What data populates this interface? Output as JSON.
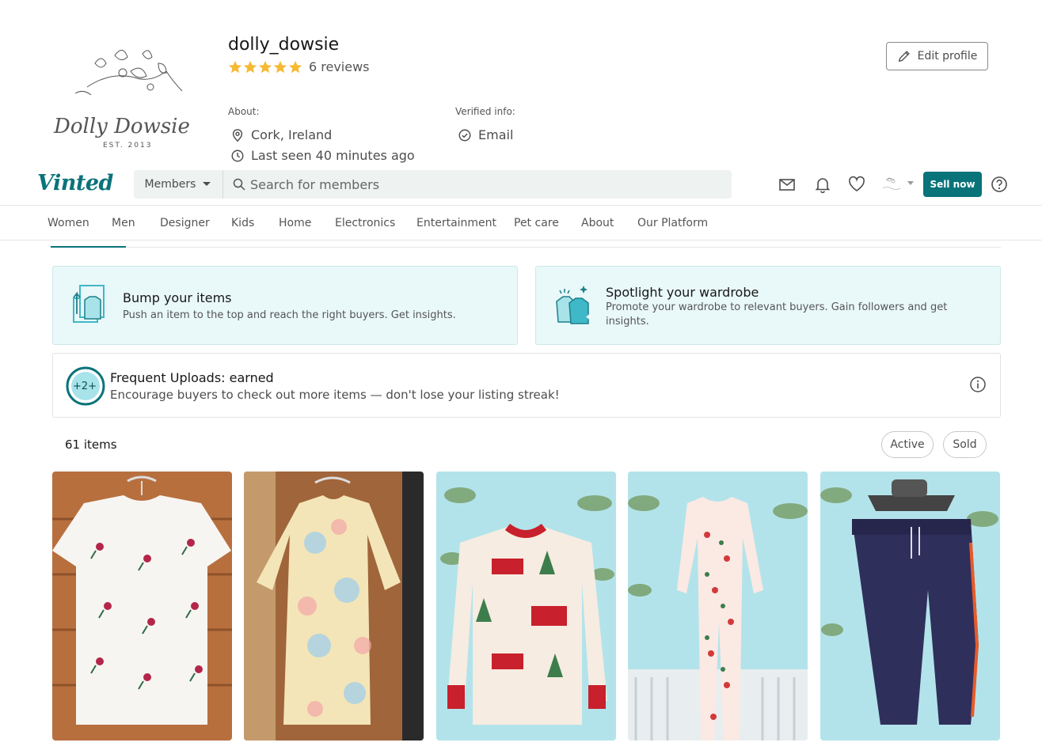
{
  "profile": {
    "username": "dolly_dowsie",
    "rating": 5,
    "reviews": "6 reviews",
    "about_heading": "About:",
    "location": "Cork, Ireland",
    "last_seen": "Last seen 40 minutes ago",
    "verified_heading": "Verified info:",
    "verified_email": "Email",
    "edit_label": "Edit profile",
    "logo_text": "Dolly Dowsie",
    "logo_est": "EST. 2013"
  },
  "header": {
    "brand": "Vinted",
    "search_scope": "Members",
    "search_placeholder": "Search for members",
    "sell_label": "Sell now"
  },
  "categories": [
    "Women",
    "Men",
    "Designer",
    "Kids",
    "Home",
    "Electronics",
    "Entertainment",
    "Pet care",
    "About",
    "Our Platform"
  ],
  "promos": {
    "bump": {
      "title": "Bump your items",
      "text": "Push an item to the top and reach the right buyers. Get insights."
    },
    "spotlight": {
      "title": "Spotlight your wardrobe",
      "text_line1": "Promote your wardrobe to relevant buyers. Gain followers and get",
      "text_line2": "insights."
    }
  },
  "frequent": {
    "title": "Frequent Uploads: earned",
    "text": "Encourage buyers to check out more items — don't lose your listing streak!"
  },
  "items": {
    "count": "61 items",
    "filters": [
      "Active",
      "Sold"
    ]
  },
  "colors": {
    "brand": "#09737a",
    "promo_bg": "#e9f8f9",
    "star": "#f5b932"
  }
}
